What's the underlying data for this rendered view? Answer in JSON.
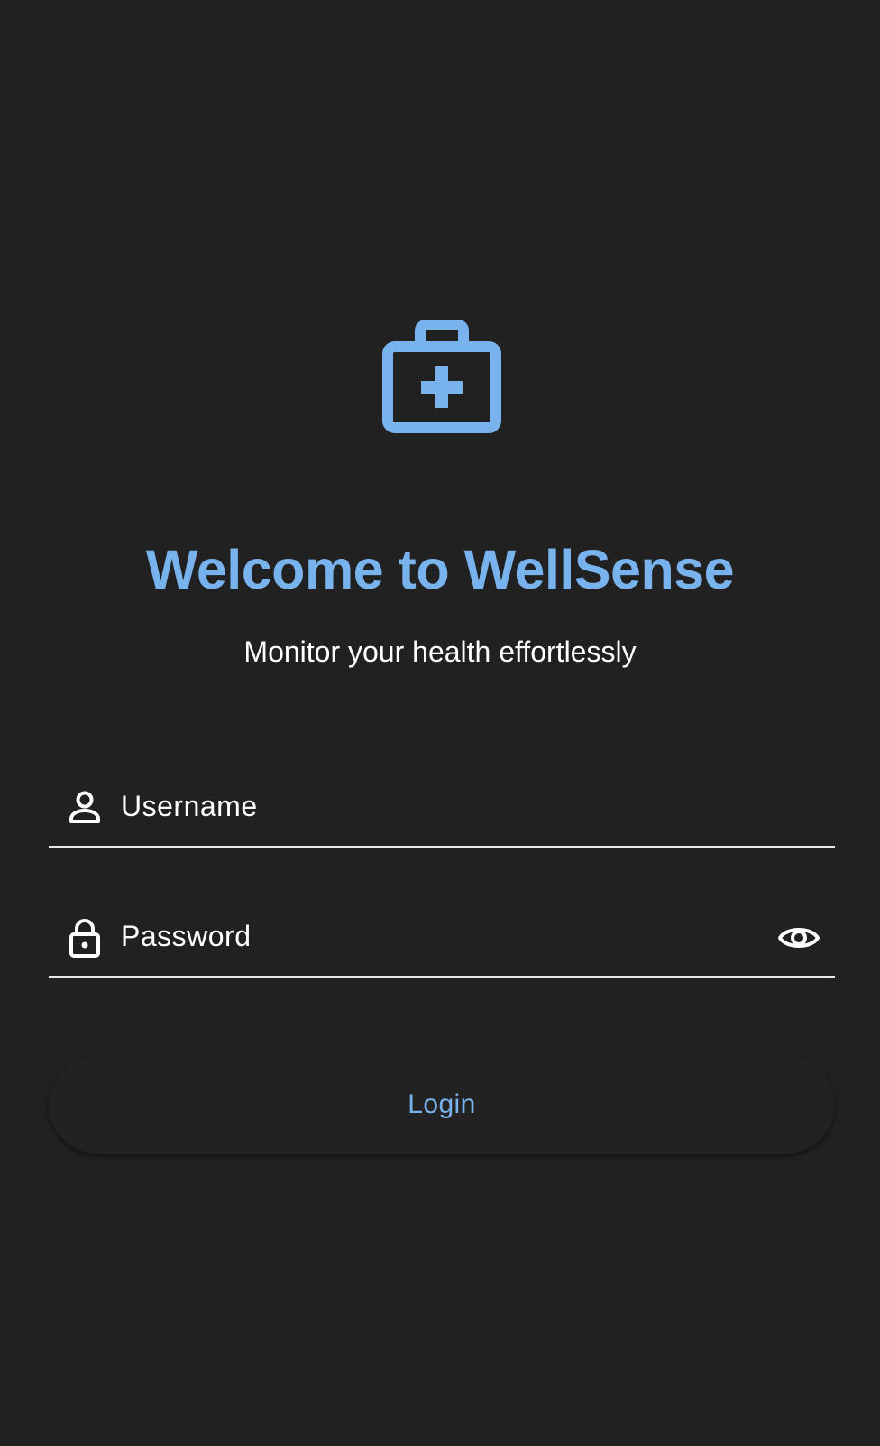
{
  "app": {
    "logo_icon": "medical-bag-icon",
    "accent_color": "#78b3ee",
    "background_color": "#212121"
  },
  "header": {
    "title": "Welcome to WellSense",
    "subtitle": "Monitor your health effortlessly"
  },
  "form": {
    "username": {
      "label": "Username",
      "icon": "person-icon"
    },
    "password": {
      "label": "Password",
      "icon": "lock-icon",
      "toggle_icon": "eye-icon"
    },
    "login_label": "Login"
  }
}
